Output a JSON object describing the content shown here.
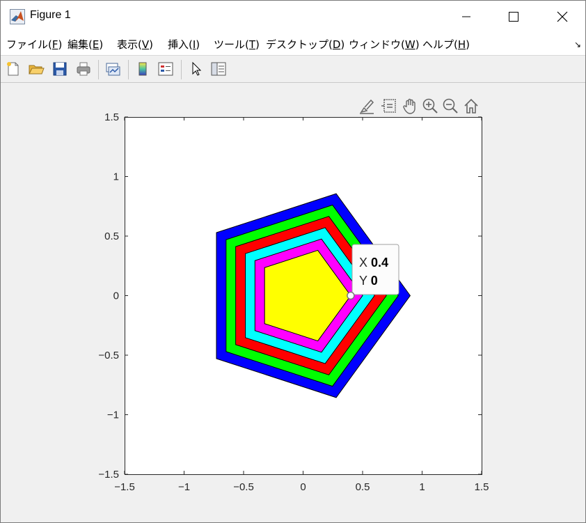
{
  "window": {
    "title": "Figure 1"
  },
  "menubar": {
    "items": [
      {
        "label": "ファイル(",
        "key": "F",
        "tail": ")"
      },
      {
        "label": "編集(",
        "key": "E",
        "tail": ")"
      },
      {
        "label": "表示(",
        "key": "V",
        "tail": ")"
      },
      {
        "label": "挿入(",
        "key": "I",
        "tail": ")"
      },
      {
        "label": "ツール(",
        "key": "T",
        "tail": ")"
      },
      {
        "label": "デスクトップ(",
        "key": "D",
        "tail": ")"
      },
      {
        "label": "ウィンドウ(",
        "key": "W",
        "tail": ")"
      },
      {
        "label": "ヘルプ(",
        "key": "H",
        "tail": ")"
      }
    ]
  },
  "toolbar": {
    "icons": [
      "new-figure-icon",
      "open-file-icon",
      "save-icon",
      "print-icon",
      "link-plot-icon",
      "colorbar-icon",
      "legend-icon",
      "edit-plot-icon",
      "property-inspector-icon"
    ]
  },
  "axes_toolbar": {
    "icons": [
      "brush-icon",
      "data-tips-icon",
      "pan-icon",
      "zoom-in-icon",
      "zoom-out-icon",
      "home-icon"
    ]
  },
  "chart_data": {
    "type": "polygon",
    "xlim": [
      -1.5,
      1.5
    ],
    "ylim": [
      -1.5,
      1.5
    ],
    "xticks": [
      -1.5,
      -1,
      -0.5,
      0,
      0.5,
      1,
      1.5
    ],
    "xtick_labels": [
      "−1.5",
      "−1",
      "−0.5",
      "0",
      "0.5",
      "1",
      "1.5"
    ],
    "yticks": [
      -1.5,
      -1,
      -0.5,
      0,
      0.5,
      1,
      1.5
    ],
    "ytick_labels": [
      "−1.5",
      "−1",
      "−0.5",
      "0",
      "0.5",
      "1",
      "1.5"
    ],
    "grid": false,
    "series": [
      {
        "radius": 0.9,
        "sides": 5,
        "color": "#0000ff"
      },
      {
        "radius": 0.8,
        "sides": 5,
        "color": "#00ff00"
      },
      {
        "radius": 0.7,
        "sides": 5,
        "color": "#ff0000"
      },
      {
        "radius": 0.6,
        "sides": 5,
        "color": "#00ffff"
      },
      {
        "radius": 0.5,
        "sides": 5,
        "color": "#ff00ff"
      },
      {
        "radius": 0.4,
        "sides": 5,
        "color": "#ffff00"
      }
    ],
    "datatip": {
      "x": 0.4,
      "y": 0,
      "x_label": "X",
      "y_label": "Y",
      "x_value": "0.4",
      "y_value": "0"
    }
  }
}
